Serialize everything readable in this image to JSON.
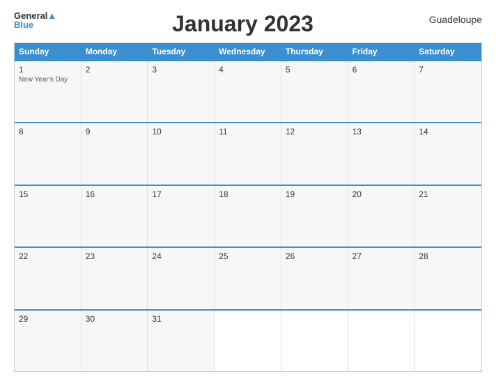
{
  "logo": {
    "top_text": "General",
    "bottom_text": "Blue"
  },
  "title": "January 2023",
  "region": "Guadeloupe",
  "day_headers": [
    "Sunday",
    "Monday",
    "Tuesday",
    "Wednesday",
    "Thursday",
    "Friday",
    "Saturday"
  ],
  "weeks": [
    {
      "days": [
        {
          "number": "1",
          "event": "New Year's Day",
          "empty": false
        },
        {
          "number": "2",
          "event": "",
          "empty": false
        },
        {
          "number": "3",
          "event": "",
          "empty": false
        },
        {
          "number": "4",
          "event": "",
          "empty": false
        },
        {
          "number": "5",
          "event": "",
          "empty": false
        },
        {
          "number": "6",
          "event": "",
          "empty": false
        },
        {
          "number": "7",
          "event": "",
          "empty": false
        }
      ]
    },
    {
      "days": [
        {
          "number": "8",
          "event": "",
          "empty": false
        },
        {
          "number": "9",
          "event": "",
          "empty": false
        },
        {
          "number": "10",
          "event": "",
          "empty": false
        },
        {
          "number": "11",
          "event": "",
          "empty": false
        },
        {
          "number": "12",
          "event": "",
          "empty": false
        },
        {
          "number": "13",
          "event": "",
          "empty": false
        },
        {
          "number": "14",
          "event": "",
          "empty": false
        }
      ]
    },
    {
      "days": [
        {
          "number": "15",
          "event": "",
          "empty": false
        },
        {
          "number": "16",
          "event": "",
          "empty": false
        },
        {
          "number": "17",
          "event": "",
          "empty": false
        },
        {
          "number": "18",
          "event": "",
          "empty": false
        },
        {
          "number": "19",
          "event": "",
          "empty": false
        },
        {
          "number": "20",
          "event": "",
          "empty": false
        },
        {
          "number": "21",
          "event": "",
          "empty": false
        }
      ]
    },
    {
      "days": [
        {
          "number": "22",
          "event": "",
          "empty": false
        },
        {
          "number": "23",
          "event": "",
          "empty": false
        },
        {
          "number": "24",
          "event": "",
          "empty": false
        },
        {
          "number": "25",
          "event": "",
          "empty": false
        },
        {
          "number": "26",
          "event": "",
          "empty": false
        },
        {
          "number": "27",
          "event": "",
          "empty": false
        },
        {
          "number": "28",
          "event": "",
          "empty": false
        }
      ]
    },
    {
      "days": [
        {
          "number": "29",
          "event": "",
          "empty": false
        },
        {
          "number": "30",
          "event": "",
          "empty": false
        },
        {
          "number": "31",
          "event": "",
          "empty": false
        },
        {
          "number": "",
          "event": "",
          "empty": true
        },
        {
          "number": "",
          "event": "",
          "empty": true
        },
        {
          "number": "",
          "event": "",
          "empty": true
        },
        {
          "number": "",
          "event": "",
          "empty": true
        }
      ]
    }
  ],
  "colors": {
    "header_bg": "#3a8fd1",
    "border": "#3a8fd1",
    "cell_bg": "#f7f7f7",
    "empty_bg": "#ffffff"
  }
}
